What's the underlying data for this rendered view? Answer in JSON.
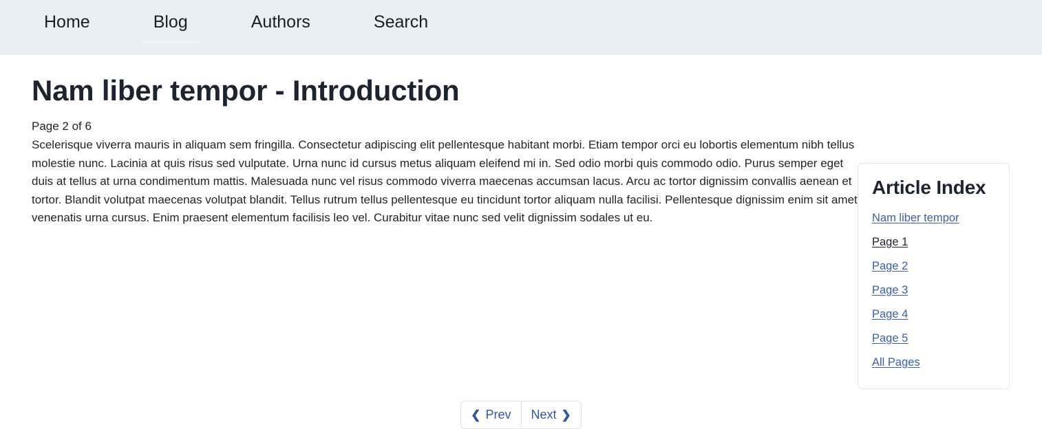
{
  "header": {
    "nav": [
      {
        "label": "Home",
        "active": false,
        "name": "nav-item-home"
      },
      {
        "label": "Blog",
        "active": true,
        "name": "nav-item-blog"
      },
      {
        "label": "Authors",
        "active": false,
        "name": "nav-item-authors"
      },
      {
        "label": "Search",
        "active": false,
        "name": "nav-item-search"
      }
    ]
  },
  "article": {
    "title": "Nam liber tempor - Introduction",
    "page_counter": "Page 2 of 6",
    "body": "Scelerisque viverra mauris in aliquam sem fringilla. Consectetur adipiscing elit pellentesque habitant morbi. Etiam tempor orci eu lobortis elementum nibh tellus molestie nunc. Lacinia at quis risus sed vulputate. Urna nunc id cursus metus aliquam eleifend mi in. Sed odio morbi quis commodo odio. Purus semper eget duis at tellus at urna condimentum mattis. Malesuada nunc vel risus commodo viverra maecenas accumsan lacus. Arcu ac tortor dignissim convallis aenean et tortor. Blandit volutpat maecenas volutpat blandit. Tellus rutrum tellus pellentesque eu tincidunt tortor aliquam nulla facilisi. Pellentesque dignissim enim sit amet venenatis urna cursus. Enim praesent elementum facilisis leo vel. Curabitur vitae nunc sed velit dignissim sodales ut eu."
  },
  "sidebar": {
    "title": "Article Index",
    "links": [
      {
        "label": "Nam liber tempor",
        "visited": false
      },
      {
        "label": "Page 1",
        "visited": true
      },
      {
        "label": "Page 2",
        "visited": false
      },
      {
        "label": "Page 3",
        "visited": false
      },
      {
        "label": "Page 4",
        "visited": false
      },
      {
        "label": "Page 5",
        "visited": false
      },
      {
        "label": "All Pages",
        "visited": false
      }
    ]
  },
  "pagination": {
    "prev_label": "Prev",
    "next_label": "Next",
    "prev_icon": "chevron-left-icon",
    "next_icon": "chevron-right-icon",
    "prev_glyph": "❮",
    "next_glyph": "❯"
  },
  "colors": {
    "header_bg": "#e9eff7",
    "link": "#3a5fa8",
    "visited_link": "#1d2430",
    "button_text": "#2f55a4",
    "heading": "#1d2430",
    "body_text": "#212529",
    "card_border": "#e2e5e9"
  }
}
